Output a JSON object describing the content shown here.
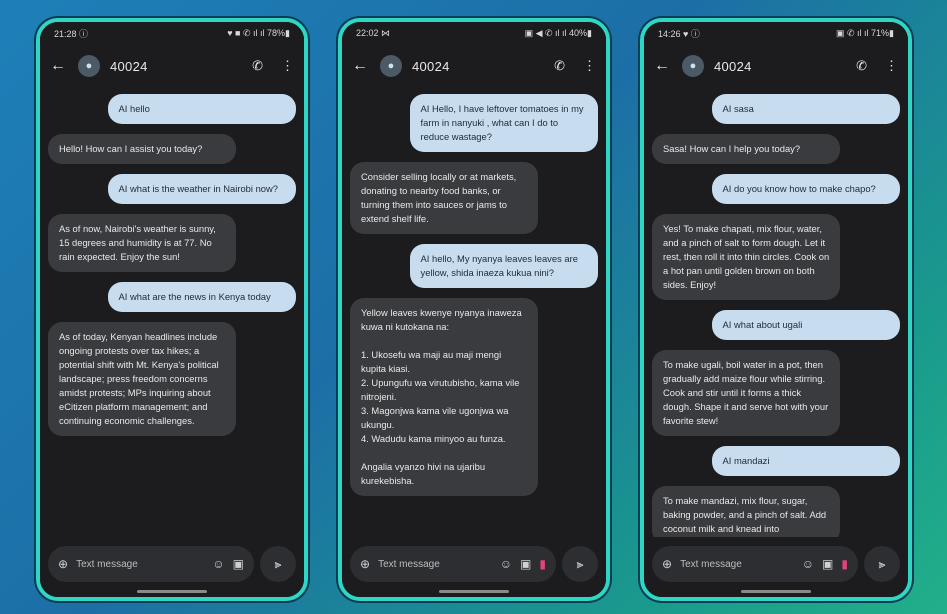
{
  "phones": [
    {
      "status": {
        "time": "21:28 ⓘ",
        "icons": "♥ ■ ✆ ıl ıl 78%▮"
      },
      "contact": "40024",
      "messages": [
        {
          "dir": "out",
          "text": "AI hello"
        },
        {
          "dir": "in",
          "text": "Hello! How can I assist you today?"
        },
        {
          "dir": "out",
          "text": "AI what is the weather in Nairobi now?"
        },
        {
          "dir": "in",
          "text": "As of now, Nairobi's weather is sunny, 15 degrees and humidity is at 77. No rain expected. Enjoy the sun!"
        },
        {
          "dir": "out",
          "text": "AI what are the news in Kenya today"
        },
        {
          "dir": "in",
          "text": "As of today, Kenyan headlines include ongoing protests over tax hikes; a potential shift with Mt. Kenya's political landscape; press freedom concerns amidst protests; MPs inquiring about eCitizen platform management; and continuing economic challenges."
        }
      ],
      "placeholder": "Text message"
    },
    {
      "status": {
        "time": "22:02 ⋈",
        "icons": "▣ ◀ ✆ ıl ıl 40%▮"
      },
      "contact": "40024",
      "messages": [
        {
          "dir": "out",
          "text": "AI Hello, I have leftover tomatoes in my farm in nanyuki , what can I do to reduce wastage?"
        },
        {
          "dir": "in",
          "text": "Consider selling locally or at markets, donating to nearby food banks, or turning them into sauces or jams to extend shelf life."
        },
        {
          "dir": "out",
          "text": "AI hello, My nyanya leaves leaves are yellow, shida inaeza kukua nini?"
        },
        {
          "dir": "in",
          "text": "Yellow leaves kwenye nyanya inaweza kuwa ni kutokana na:\n\n1. Ukosefu wa maji au maji mengi kupita kiasi.\n2. Upungufu wa virutubisho, kama vile nitrojeni.\n3. Magonjwa kama vile ugonjwa wa ukungu.\n4. Wadudu kama minyoo au funza.\n\nAngalia vyanzo hivi na ujaribu kurekebisha."
        }
      ],
      "placeholder": "Text message"
    },
    {
      "status": {
        "time": "14:26 ♥ ⓘ",
        "icons": "▣ ✆ ıl ıl 71%▮"
      },
      "contact": "40024",
      "messages": [
        {
          "dir": "out",
          "text": "AI sasa"
        },
        {
          "dir": "in",
          "text": "Sasa! How can I help you today?"
        },
        {
          "dir": "out",
          "text": "AI do you know how to make chapo?"
        },
        {
          "dir": "in",
          "text": "Yes! To make chapati, mix flour, water, and a pinch of salt to form dough. Let it rest, then roll it into thin circles. Cook on a hot pan until golden brown on both sides. Enjoy!"
        },
        {
          "dir": "out",
          "text": "AI what about ugali"
        },
        {
          "dir": "in",
          "text": "To make ugali, boil water in a pot, then gradually add maize flour while stirring. Cook and stir until it forms a thick dough. Shape it and serve hot with your favorite stew!"
        },
        {
          "dir": "out",
          "text": "AI mandazi"
        },
        {
          "dir": "in",
          "text": "To make mandazi, mix flour, sugar, baking powder, and a pinch of salt. Add coconut milk and knead into"
        }
      ],
      "placeholder": "Text message"
    }
  ],
  "icons": {
    "back": "arrow-left-icon",
    "avatar": "person-icon",
    "call": "phone-icon",
    "more": "more-vert-icon",
    "add": "add-circle-icon",
    "emoji": "emoji-icon",
    "gallery": "gallery-icon",
    "attach": "attach-icon",
    "voice": "voice-icon"
  },
  "colors": {
    "outgoing_bubble": "#c8dcef",
    "incoming_bubble": "#3a3b3e",
    "frame": "#2fd6c6"
  }
}
